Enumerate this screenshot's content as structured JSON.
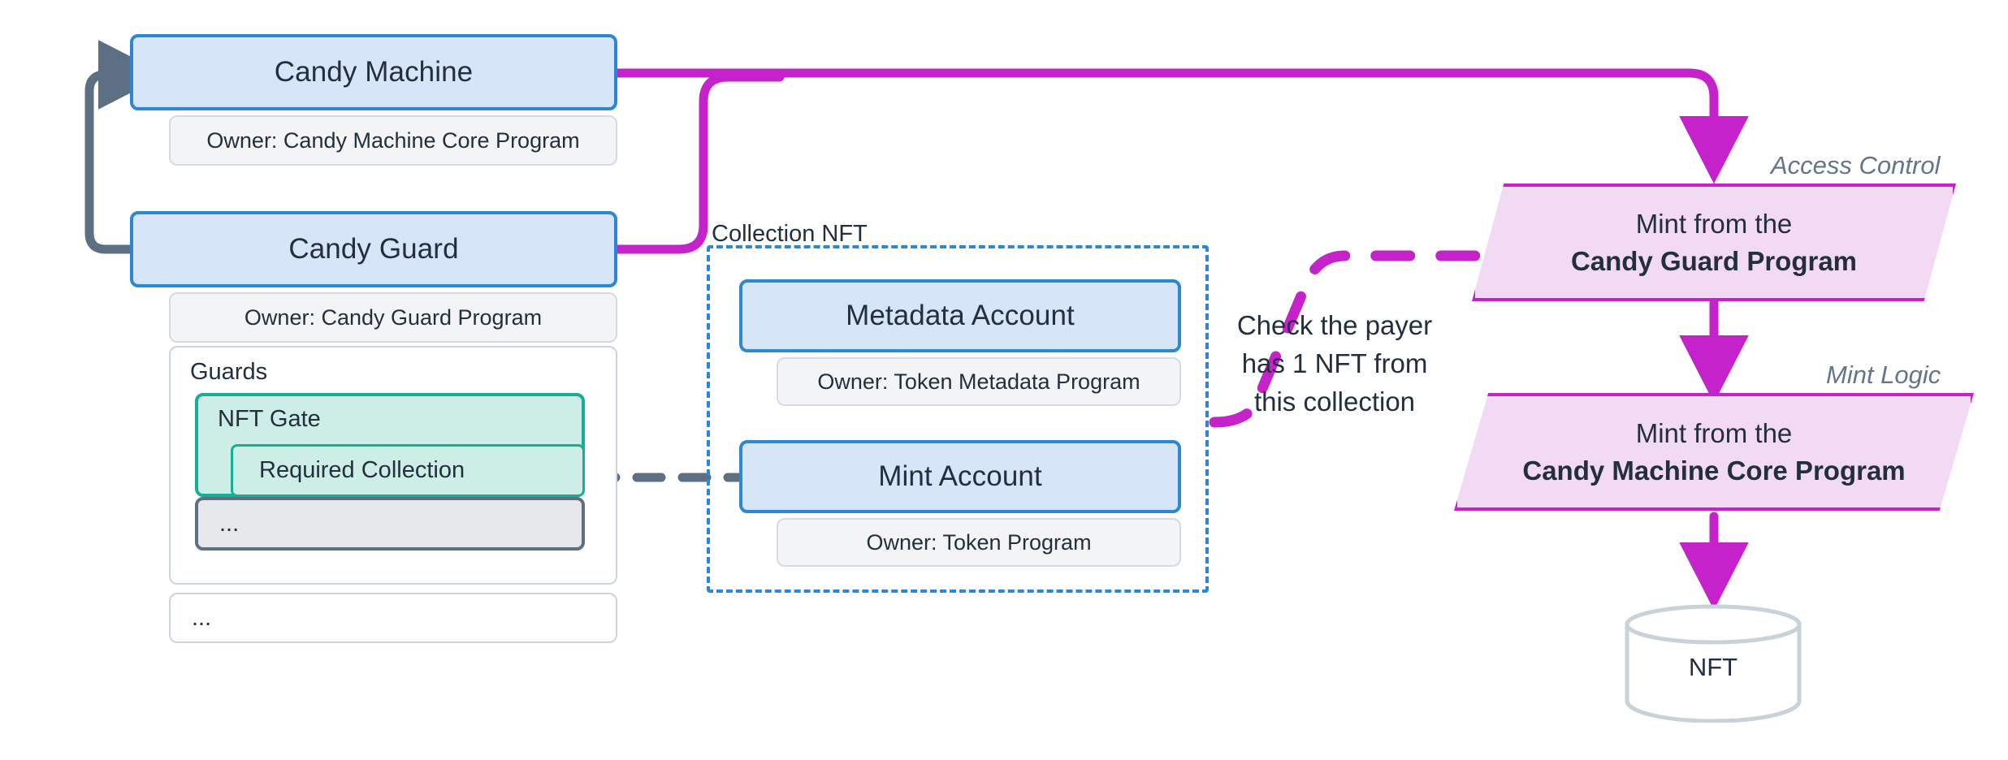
{
  "diagram": {
    "title": "Candy Machine / Candy Guard NFT Gate flow",
    "colors": {
      "account_fill": "#d7e5f8",
      "account_border": "#2c87d5",
      "owner_fill": "#f3f4f6",
      "owner_border": "#d4dbe3",
      "guard_fill": "#cdeee6",
      "guard_border": "#15af91",
      "process_fill": "#f2daf5",
      "process_border": "#c522cc",
      "link_magenta": "#c522cc",
      "link_grey": "#5d7083",
      "panel_border": "#cdd6df",
      "text": "#232f3e",
      "side_label": "#65748a"
    }
  },
  "candy_machine": {
    "title": "Candy Machine",
    "owner": "Owner: Candy Machine Core Program"
  },
  "candy_guard": {
    "title": "Candy Guard",
    "owner": "Owner: Candy Guard Program",
    "guards_label": "Guards",
    "nft_gate": {
      "label": "NFT Gate",
      "required_collection": "Required Collection",
      "more": "..."
    },
    "more": "..."
  },
  "collection_nft": {
    "label": "Collection NFT",
    "accounts": [
      {
        "title": "Metadata Account",
        "owner": "Owner: Token Metadata Program"
      },
      {
        "title": "Mint Account",
        "owner": "Owner: Token Program"
      }
    ]
  },
  "note": {
    "text": "Check the payer\nhas 1 NFT from\nthis collection"
  },
  "processes": [
    {
      "side_label": "Access Control",
      "line1": "Mint from the",
      "line2": "Candy Guard Program"
    },
    {
      "side_label": "Mint Logic",
      "line1": "Mint from the",
      "line2": "Candy Machine Core Program"
    }
  ],
  "output": {
    "label": "NFT"
  }
}
